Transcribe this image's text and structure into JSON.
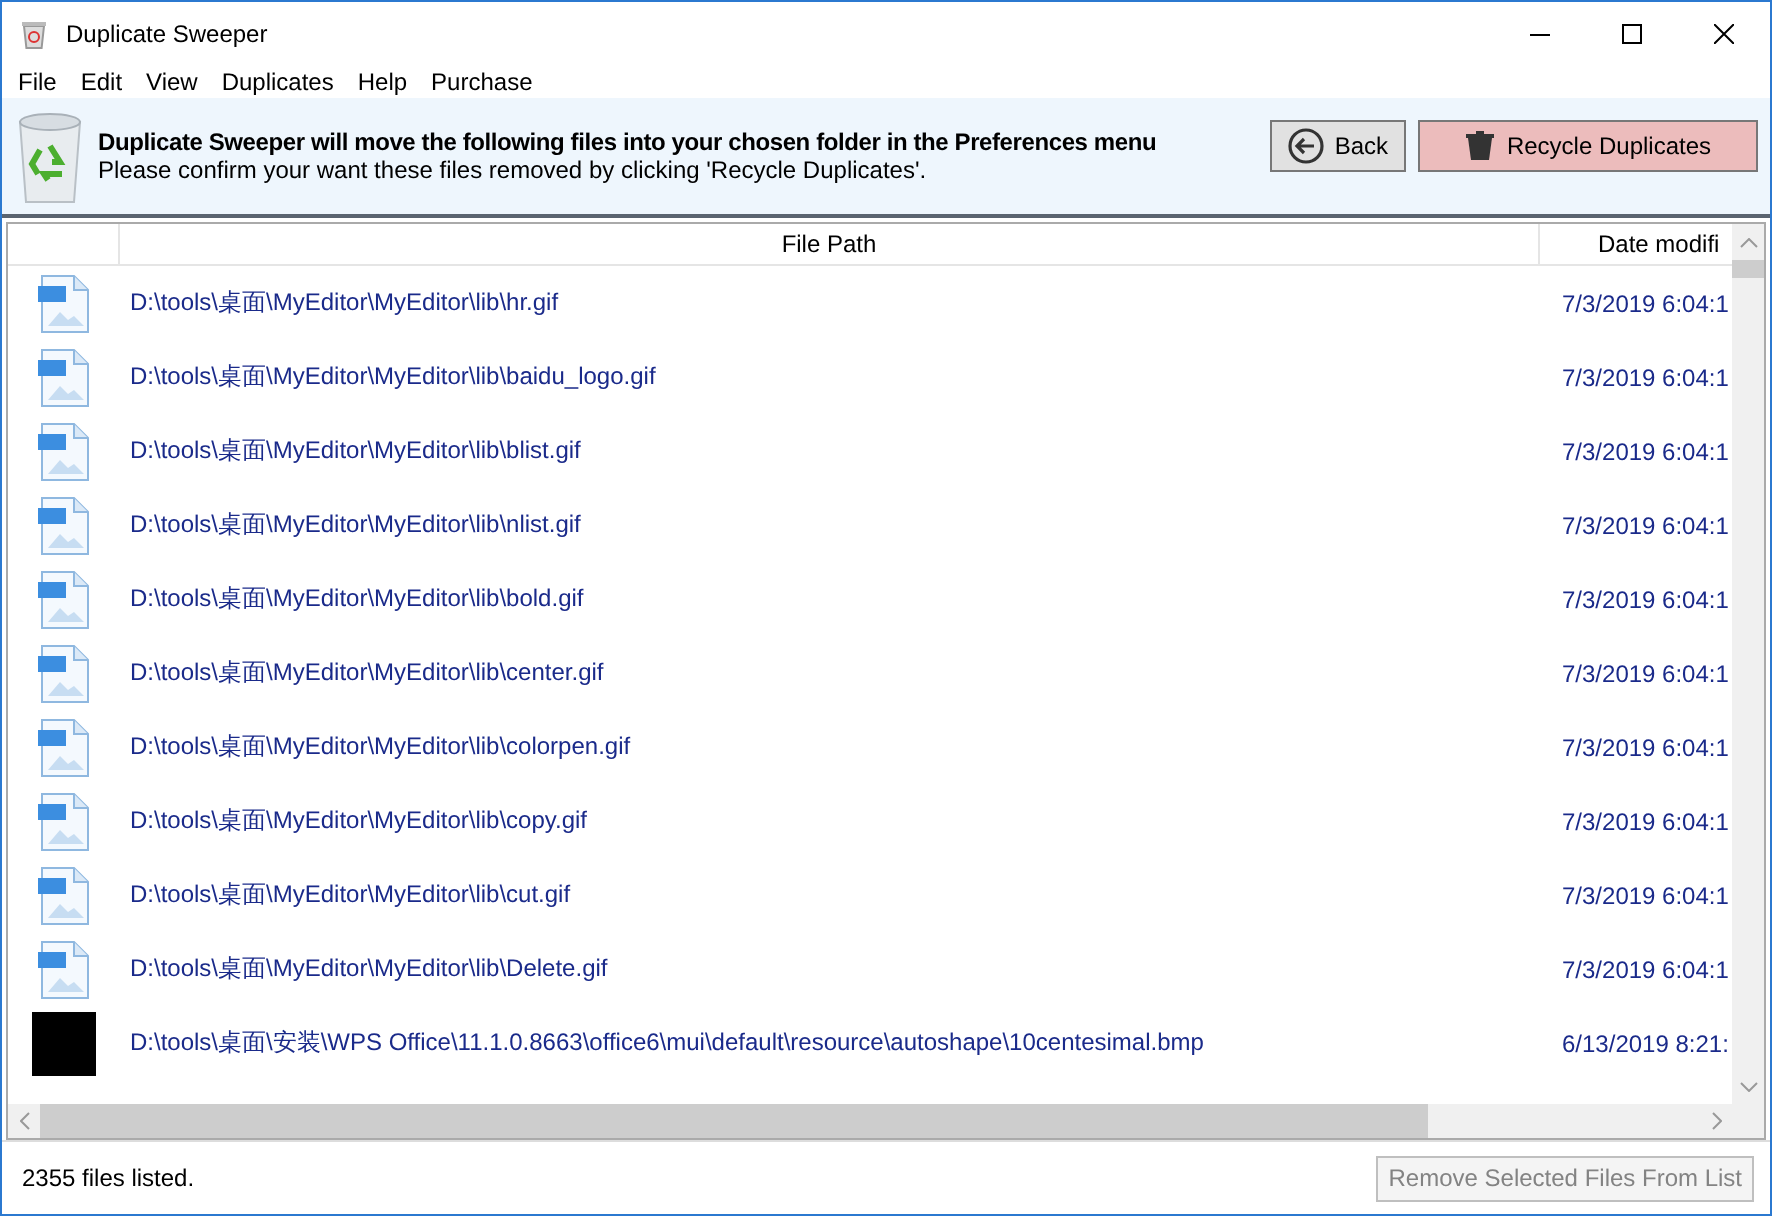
{
  "window": {
    "title": "Duplicate Sweeper"
  },
  "menu": [
    "File",
    "Edit",
    "View",
    "Duplicates",
    "Help",
    "Purchase"
  ],
  "banner": {
    "heading": "Duplicate Sweeper will move the following files into your chosen folder in the Preferences menu",
    "message": "Please confirm your want these files removed by clicking 'Recycle Duplicates'.",
    "back_button": "Back",
    "recycle_button": "Recycle Duplicates"
  },
  "table": {
    "columns": [
      "File Path",
      "Date modifi"
    ],
    "rows": [
      {
        "kind": "gif",
        "path": "D:\\tools\\桌面\\MyEditor\\MyEditor\\lib\\hr.gif",
        "date": "7/3/2019 6:04:1"
      },
      {
        "kind": "gif",
        "path": "D:\\tools\\桌面\\MyEditor\\MyEditor\\lib\\baidu_logo.gif",
        "date": "7/3/2019 6:04:1"
      },
      {
        "kind": "gif",
        "path": "D:\\tools\\桌面\\MyEditor\\MyEditor\\lib\\blist.gif",
        "date": "7/3/2019 6:04:1"
      },
      {
        "kind": "gif",
        "path": "D:\\tools\\桌面\\MyEditor\\MyEditor\\lib\\nlist.gif",
        "date": "7/3/2019 6:04:1"
      },
      {
        "kind": "gif",
        "path": "D:\\tools\\桌面\\MyEditor\\MyEditor\\lib\\bold.gif",
        "date": "7/3/2019 6:04:1"
      },
      {
        "kind": "gif",
        "path": "D:\\tools\\桌面\\MyEditor\\MyEditor\\lib\\center.gif",
        "date": "7/3/2019 6:04:1"
      },
      {
        "kind": "gif",
        "path": "D:\\tools\\桌面\\MyEditor\\MyEditor\\lib\\colorpen.gif",
        "date": "7/3/2019 6:04:1"
      },
      {
        "kind": "gif",
        "path": "D:\\tools\\桌面\\MyEditor\\MyEditor\\lib\\copy.gif",
        "date": "7/3/2019 6:04:1"
      },
      {
        "kind": "gif",
        "path": "D:\\tools\\桌面\\MyEditor\\MyEditor\\lib\\cut.gif",
        "date": "7/3/2019 6:04:1"
      },
      {
        "kind": "gif",
        "path": "D:\\tools\\桌面\\MyEditor\\MyEditor\\lib\\Delete.gif",
        "date": "7/3/2019 6:04:1"
      },
      {
        "kind": "bmp",
        "path": "D:\\tools\\桌面\\安装\\WPS Office\\11.1.0.8663\\office6\\mui\\default\\resource\\autoshape\\10centesimal.bmp",
        "date": "6/13/2019 8:21:"
      }
    ]
  },
  "status_bar": {
    "count": "2355 files listed.",
    "remove_button": {
      "label": "Remove Selected Files From List",
      "disabled": true
    }
  }
}
